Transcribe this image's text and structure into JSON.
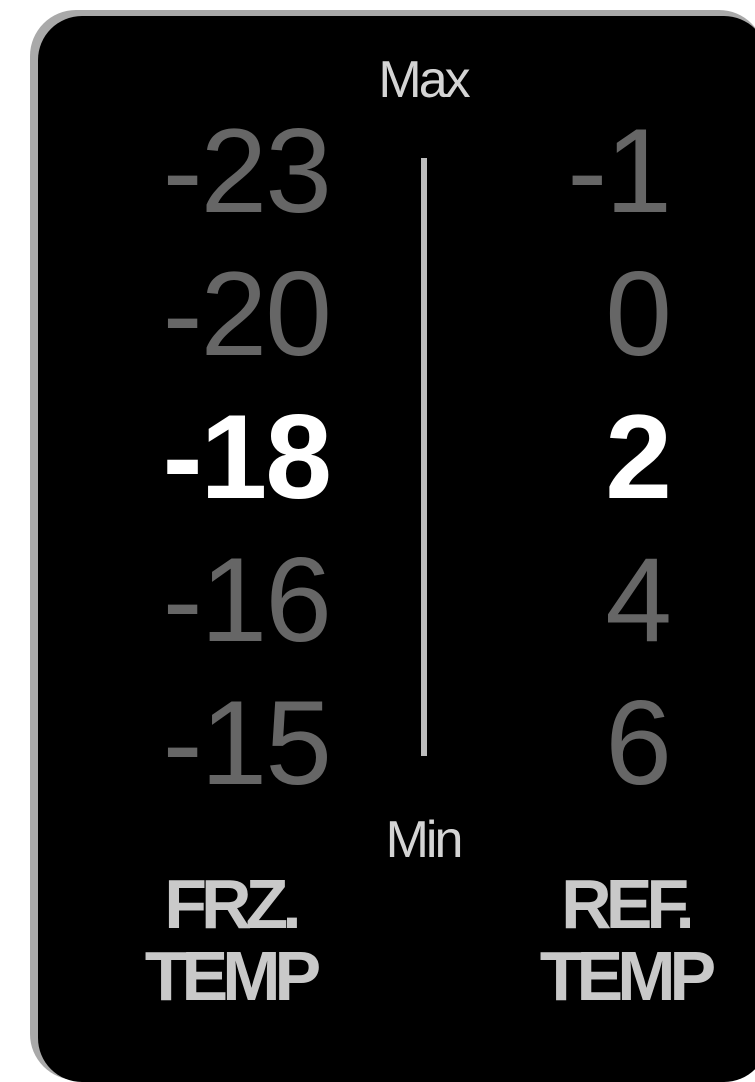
{
  "scale": {
    "max_label": "Max",
    "min_label": "Min"
  },
  "freezer": {
    "values": [
      "-23",
      "-20",
      "-18",
      "-16",
      "-15"
    ],
    "selected_index": 2,
    "caption_line1": "FRZ.",
    "caption_line2": "TEMP"
  },
  "refrigerator": {
    "values": [
      "-1",
      "0",
      "2",
      "4",
      "6"
    ],
    "selected_index": 2,
    "caption_line1": "REF.",
    "caption_line2": "TEMP"
  },
  "colors": {
    "panel": "#000000",
    "active_value": "#ffffff",
    "inactive_value": "#666666",
    "caption": "#c9c9c9"
  }
}
